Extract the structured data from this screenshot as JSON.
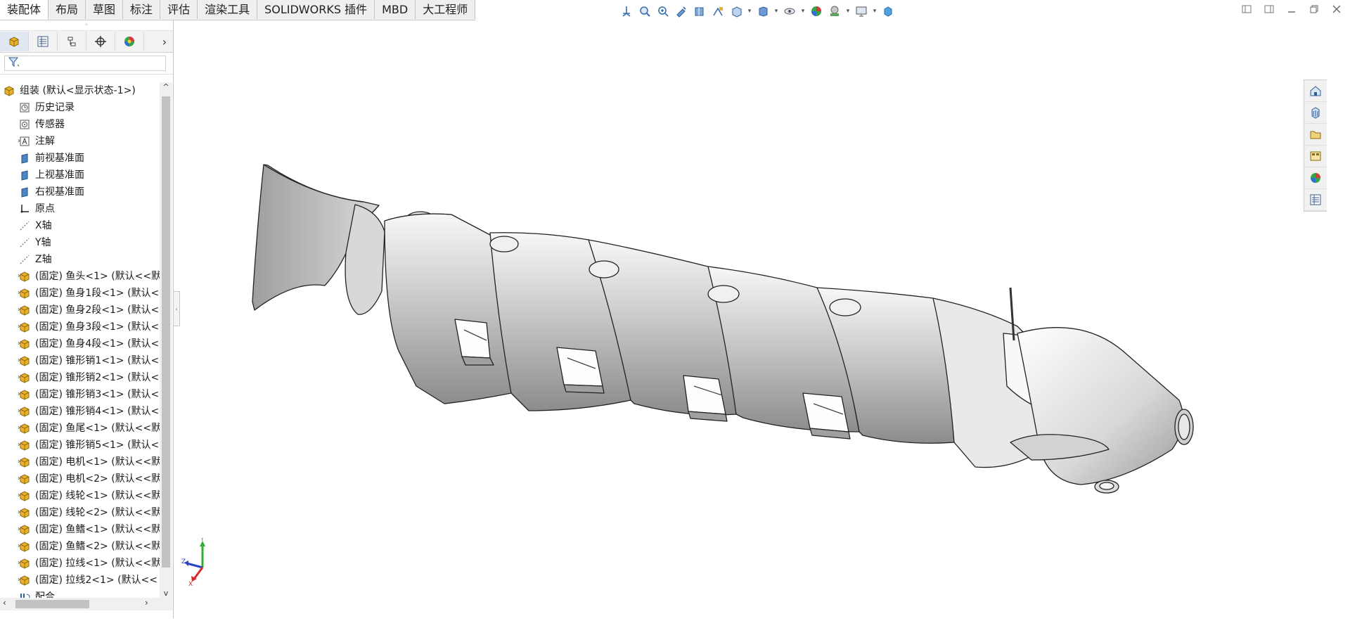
{
  "tabs": [
    {
      "label": "装配体",
      "active": true
    },
    {
      "label": "布局"
    },
    {
      "label": "草图"
    },
    {
      "label": "标注"
    },
    {
      "label": "评估"
    },
    {
      "label": "渲染工具"
    },
    {
      "label": "SOLIDWORKS 插件"
    },
    {
      "label": "MBD"
    },
    {
      "label": "大工程师"
    }
  ],
  "heads_up_toolbar": [
    "view-orientation-icon",
    "zoom-to-fit-icon",
    "zoom-to-area-icon",
    "previous-view-icon",
    "section-view-icon",
    "dynamic-annotation-icon",
    "view-orientation-cube-icon",
    "display-style-icon",
    "hide-show-items-icon",
    "edit-appearance-icon",
    "apply-scene-icon",
    "view-settings-icon",
    "display-pane-icon"
  ],
  "panel_tabs": [
    "featuremanager-icon",
    "propertymanager-icon",
    "configurationmanager-icon",
    "dimxpertmanager-icon",
    "displaymanager-icon"
  ],
  "tree": {
    "root": "组装 (默认<显示状态-1>)",
    "items": [
      {
        "label": "历史记录",
        "icon": "history-icon",
        "expand": false
      },
      {
        "label": "传感器",
        "icon": "sensor-icon",
        "expand": false
      },
      {
        "label": "注解",
        "icon": "annotation-icon",
        "expand": true
      },
      {
        "label": "前视基准面",
        "icon": "plane-icon",
        "expand": false
      },
      {
        "label": "上视基准面",
        "icon": "plane-icon",
        "expand": false
      },
      {
        "label": "右视基准面",
        "icon": "plane-icon",
        "expand": false
      },
      {
        "label": "原点",
        "icon": "origin-icon",
        "expand": false
      },
      {
        "label": "X轴",
        "icon": "axis-icon",
        "expand": false
      },
      {
        "label": "Y轴",
        "icon": "axis-icon",
        "expand": false
      },
      {
        "label": "Z轴",
        "icon": "axis-icon",
        "expand": false
      },
      {
        "label": "(固定) 鱼头<1> (默认<<默",
        "icon": "part-icon",
        "expand": true
      },
      {
        "label": "(固定) 鱼身1段<1> (默认<",
        "icon": "part-icon",
        "expand": true
      },
      {
        "label": "(固定) 鱼身2段<1> (默认<",
        "icon": "part-icon",
        "expand": true
      },
      {
        "label": "(固定) 鱼身3段<1> (默认<",
        "icon": "part-icon",
        "expand": true
      },
      {
        "label": "(固定) 鱼身4段<1> (默认<",
        "icon": "part-icon",
        "expand": true
      },
      {
        "label": "(固定) 锥形销1<1> (默认<",
        "icon": "part-icon",
        "expand": true
      },
      {
        "label": "(固定) 锥形销2<1> (默认<",
        "icon": "part-icon",
        "expand": true
      },
      {
        "label": "(固定) 锥形销3<1> (默认<",
        "icon": "part-icon",
        "expand": true
      },
      {
        "label": "(固定) 锥形销4<1> (默认<",
        "icon": "part-icon",
        "expand": true
      },
      {
        "label": "(固定) 鱼尾<1> (默认<<默",
        "icon": "part-icon",
        "expand": true
      },
      {
        "label": "(固定) 锥形销5<1> (默认<",
        "icon": "part-icon",
        "expand": true
      },
      {
        "label": "(固定) 电机<1> (默认<<默",
        "icon": "part-icon",
        "expand": true
      },
      {
        "label": "(固定) 电机<2> (默认<<默",
        "icon": "part-icon",
        "expand": true
      },
      {
        "label": "(固定) 线轮<1> (默认<<默",
        "icon": "part-icon",
        "expand": true
      },
      {
        "label": "(固定) 线轮<2> (默认<<默",
        "icon": "part-icon",
        "expand": true
      },
      {
        "label": "(固定) 鱼鳍<1> (默认<<默",
        "icon": "part-icon",
        "expand": true
      },
      {
        "label": "(固定) 鱼鳍<2> (默认<<默",
        "icon": "part-icon",
        "expand": true
      },
      {
        "label": "(固定) 拉线<1> (默认<<默",
        "icon": "part-icon",
        "expand": true
      },
      {
        "label": "(固定) 拉线2<1> (默认<<",
        "icon": "part-icon",
        "expand": true
      },
      {
        "label": "配合",
        "icon": "mates-icon",
        "expand": false
      }
    ]
  },
  "task_pane": [
    "solidworks-resources-icon",
    "design-library-icon",
    "file-explorer-icon",
    "view-palette-icon",
    "appearances-icon",
    "custom-properties-icon"
  ],
  "triad": {
    "x": "X",
    "y": "Y",
    "z": "Z",
    "x_color": "#d62a2a",
    "y_color": "#2fae2f",
    "z_color": "#2a44c8"
  },
  "colors": {
    "accent": "#1e6fc8",
    "part_yellow": "#e8b32a"
  }
}
